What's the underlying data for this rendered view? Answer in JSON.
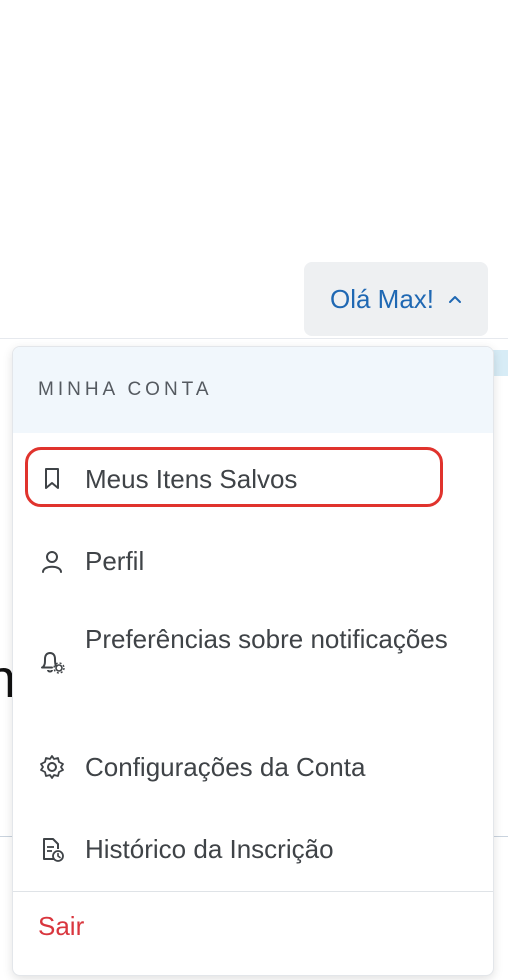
{
  "header": {
    "greeting_label": "Olá Max!",
    "greeting_icon": "chevron-up-icon"
  },
  "menu": {
    "heading": "MINHA CONTA",
    "items": [
      {
        "label": "Meus Itens Salvos",
        "icon": "bookmark-icon"
      },
      {
        "label": "Perfil",
        "icon": "person-icon"
      },
      {
        "label": "Preferências sobre notificações",
        "icon": "bell-settings-icon"
      },
      {
        "label": "Configurações da Conta",
        "icon": "gear-icon"
      },
      {
        "label": "Histórico da Inscrição",
        "icon": "document-clock-icon"
      }
    ],
    "signout_label": "Sair"
  },
  "background": {
    "partial_glyph": "n"
  },
  "colors": {
    "greeting_text": "#1f68b3",
    "greeting_bg": "#eef0f2",
    "header_bg": "#f1f7fc",
    "highlight_ring": "#e0332d",
    "signout_text": "#d9363e",
    "item_text": "#3f4347"
  }
}
